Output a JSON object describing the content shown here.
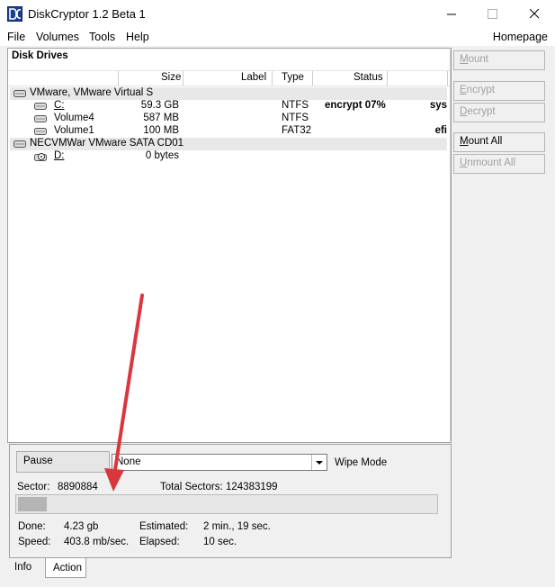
{
  "window": {
    "title": "DiskCryptor 1.2 Beta 1",
    "icon": "diskcryptor-logo-icon"
  },
  "menu": {
    "items": [
      "File",
      "Volumes",
      "Tools",
      "Help"
    ],
    "homepage": "Homepage"
  },
  "drives": {
    "panel_title": "Disk Drives",
    "columns": {
      "size": "Size",
      "label": "Label",
      "type": "Type",
      "status": "Status"
    },
    "groups": [
      {
        "name": "VMware, VMware Virtual S",
        "volumes": [
          {
            "name": "C:",
            "size": "59.3 GB",
            "label": "",
            "type": "NTFS",
            "status": "encrypt 07%",
            "flag": "sys"
          },
          {
            "name": "Volume4",
            "size": "587 MB",
            "label": "",
            "type": "NTFS",
            "status": "",
            "flag": ""
          },
          {
            "name": "Volume1",
            "size": "100 MB",
            "label": "",
            "type": "FAT32",
            "status": "",
            "flag": "efi"
          }
        ]
      },
      {
        "name": "NECVMWar VMware SATA CD01",
        "volumes": [
          {
            "name": "D:",
            "size": "0 bytes",
            "label": "",
            "type": "",
            "status": "",
            "flag": ""
          }
        ]
      }
    ]
  },
  "side_buttons": {
    "mount": {
      "pre": "",
      "key": "M",
      "post": "ount"
    },
    "encrypt": {
      "pre": "",
      "key": "E",
      "post": "ncrypt"
    },
    "decrypt": {
      "pre": "",
      "key": "D",
      "post": "ecrypt"
    },
    "mount_all": {
      "pre": "",
      "key": "M",
      "post": "ount All"
    },
    "unmount_all": {
      "pre": "",
      "key": "U",
      "post": "nmount All"
    }
  },
  "action": {
    "pause_label": "Pause",
    "wipe_mode_value": "None",
    "wipe_mode_label": "Wipe Mode",
    "sector_label": "Sector:",
    "sector_value": "8890884",
    "total_sectors_label": "Total Sectors:",
    "total_sectors_value": "124383199",
    "progress_fraction": 0.07,
    "done_label": "Done:",
    "done_value": "4.23 gb",
    "speed_label": "Speed:",
    "speed_value": "403.8 mb/sec.",
    "estimated_label": "Estimated:",
    "estimated_value": "2 min., 19 sec.",
    "elapsed_label": "Elapsed:",
    "elapsed_value": "10 sec."
  },
  "tabs": {
    "info": "Info",
    "action": "Action"
  },
  "annotation": {
    "color": "#d9363e"
  }
}
